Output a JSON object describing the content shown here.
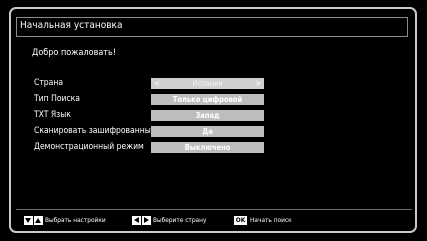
{
  "header": {
    "title": "Начальная установка"
  },
  "welcome_text": "Добро пожаловать!",
  "settings": [
    {
      "label": "Страна",
      "value": "Испания",
      "selected": true
    },
    {
      "label": "Тип Поиска",
      "value": "Только цифровой",
      "selected": false
    },
    {
      "label": "TXT Язык",
      "value": "Запад",
      "selected": false
    },
    {
      "label": "Сканировать зашифрованные усл..",
      "value": "Да",
      "selected": false
    },
    {
      "label": "Демонстрационный режим",
      "value": "Выключено",
      "selected": false
    }
  ],
  "footer": {
    "select_settings": "Выбрать настройки",
    "select_country": "Выберите страну",
    "ok_key": "OK",
    "start_search": "Начать поиск"
  },
  "icons": {
    "down": "arrow-down-icon",
    "up": "arrow-up-icon",
    "left": "arrow-left-icon",
    "right": "arrow-right-icon"
  }
}
